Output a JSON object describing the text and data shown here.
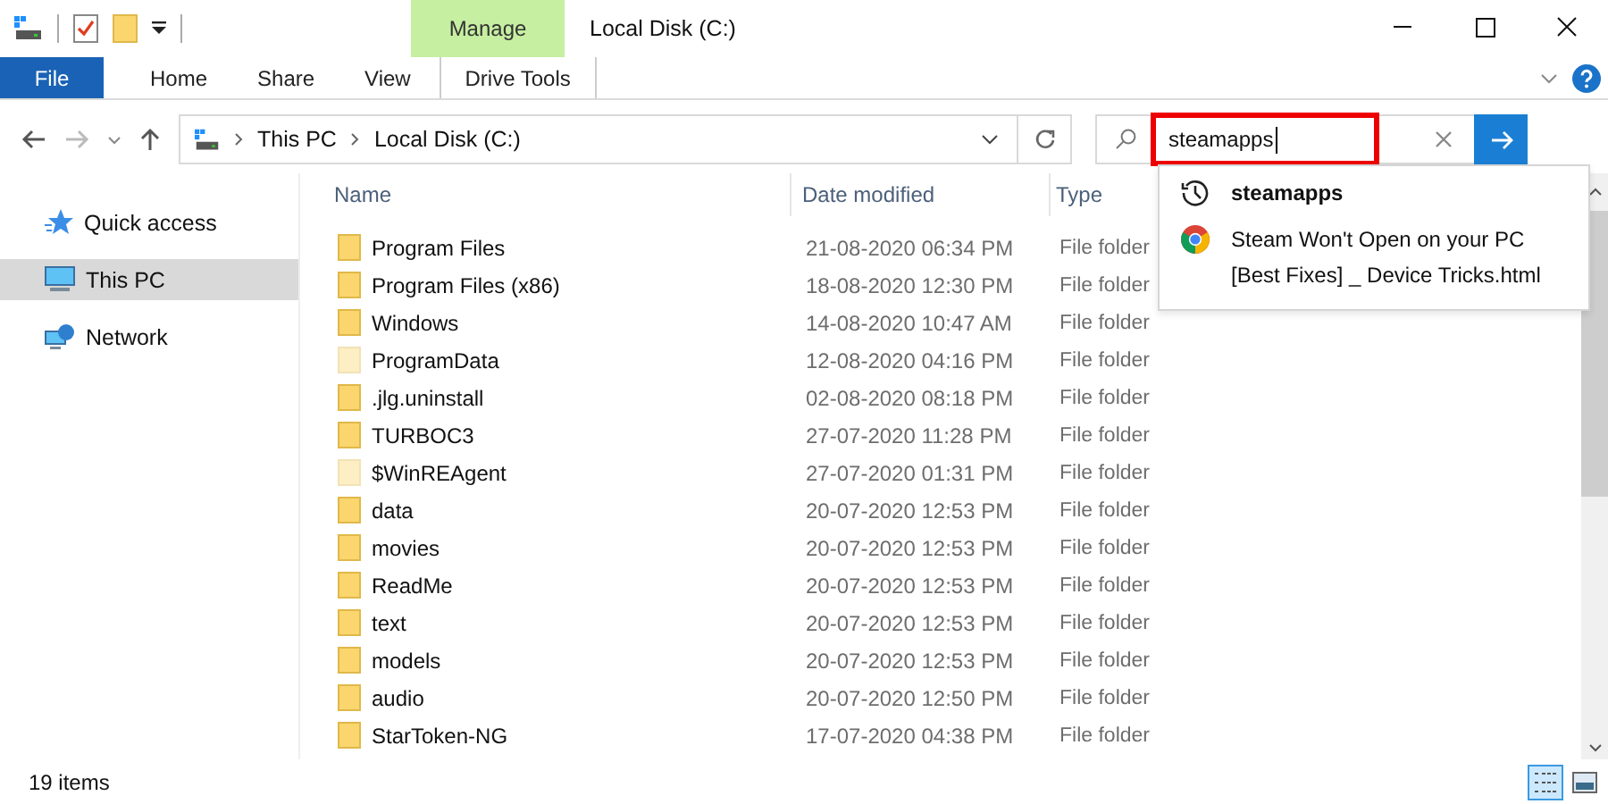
{
  "window": {
    "title": "Local Disk (C:)"
  },
  "contextual_tab": {
    "label": "Manage"
  },
  "ribbon_tabs": [
    {
      "label": "File",
      "kind": "file",
      "selected": false
    },
    {
      "label": "Home",
      "kind": "tab",
      "selected": false
    },
    {
      "label": "Share",
      "kind": "tab",
      "selected": false
    },
    {
      "label": "View",
      "kind": "tab",
      "selected": false
    },
    {
      "label": "Drive Tools",
      "kind": "contextual",
      "selected": false
    }
  ],
  "address": {
    "crumbs": [
      "This PC",
      "Local Disk (C:)"
    ]
  },
  "search": {
    "value": "steamapps",
    "highlighted": true
  },
  "suggestions": [
    {
      "kind": "history",
      "text": "steamapps"
    },
    {
      "kind": "web-page",
      "text": "Steam Won't Open on your PC [Best Fixes] _ Device Tricks.html"
    }
  ],
  "sidebar": {
    "items": [
      {
        "label": "Quick access",
        "kind": "star",
        "selected": false
      },
      {
        "label": "This PC",
        "kind": "pc",
        "selected": true
      },
      {
        "label": "Network",
        "kind": "network",
        "selected": false
      }
    ]
  },
  "table": {
    "columns": [
      "Name",
      "Date modified",
      "Type"
    ],
    "rows": [
      {
        "name": "Program Files",
        "date": "21-08-2020 06:34 PM",
        "type": "File folder",
        "hidden": false
      },
      {
        "name": "Program Files (x86)",
        "date": "18-08-2020 12:30 PM",
        "type": "File folder",
        "hidden": false
      },
      {
        "name": "Windows",
        "date": "14-08-2020 10:47 AM",
        "type": "File folder",
        "hidden": false
      },
      {
        "name": "ProgramData",
        "date": "12-08-2020 04:16 PM",
        "type": "File folder",
        "hidden": true
      },
      {
        "name": ".jlg.uninstall",
        "date": "02-08-2020 08:18 PM",
        "type": "File folder",
        "hidden": false
      },
      {
        "name": "TURBOC3",
        "date": "27-07-2020 11:28 PM",
        "type": "File folder",
        "hidden": false
      },
      {
        "name": "$WinREAgent",
        "date": "27-07-2020 01:31 PM",
        "type": "File folder",
        "hidden": true
      },
      {
        "name": "data",
        "date": "20-07-2020 12:53 PM",
        "type": "File folder",
        "hidden": false
      },
      {
        "name": "movies",
        "date": "20-07-2020 12:53 PM",
        "type": "File folder",
        "hidden": false
      },
      {
        "name": "ReadMe",
        "date": "20-07-2020 12:53 PM",
        "type": "File folder",
        "hidden": false
      },
      {
        "name": "text",
        "date": "20-07-2020 12:53 PM",
        "type": "File folder",
        "hidden": false
      },
      {
        "name": "models",
        "date": "20-07-2020 12:53 PM",
        "type": "File folder",
        "hidden": false
      },
      {
        "name": "audio",
        "date": "20-07-2020 12:50 PM",
        "type": "File folder",
        "hidden": false
      },
      {
        "name": "StarToken-NG",
        "date": "17-07-2020 04:38 PM",
        "type": "File folder",
        "hidden": false
      }
    ]
  },
  "status_bar": {
    "text": "19 items",
    "details_view": {
      "selected": true
    },
    "tiles_view": {
      "selected": false
    }
  }
}
